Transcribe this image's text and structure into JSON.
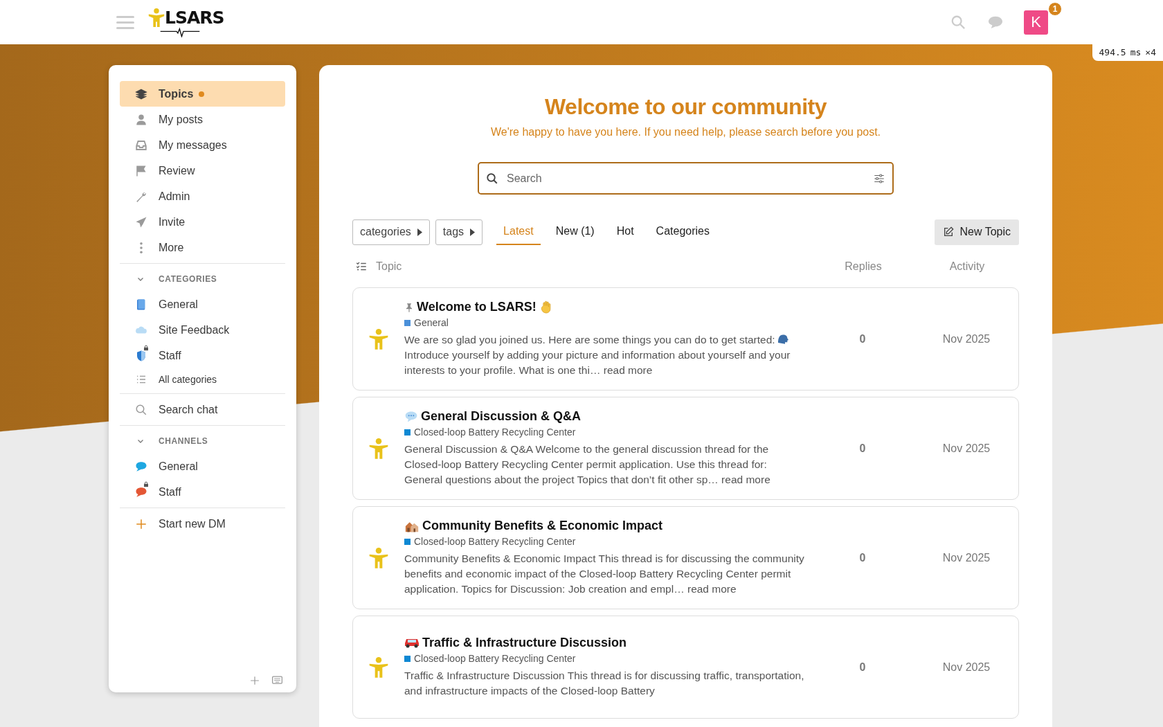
{
  "header": {
    "logo": "LSARS",
    "avatar": {
      "letter": "K",
      "notifications": "1"
    }
  },
  "perf_badge": {
    "value": "494.5",
    "unit": "ms",
    "count": "×4"
  },
  "sidebar": {
    "items": [
      {
        "label": "Topics",
        "selected": true,
        "has_new": true,
        "kind": "layers"
      },
      {
        "label": "My posts",
        "selected": false,
        "has_new": false,
        "kind": "user"
      },
      {
        "label": "My messages",
        "selected": false,
        "has_new": false,
        "kind": "inbox"
      },
      {
        "label": "Review",
        "selected": false,
        "has_new": false,
        "kind": "flag"
      },
      {
        "label": "Admin",
        "selected": false,
        "has_new": false,
        "kind": "wrench"
      },
      {
        "label": "Invite",
        "selected": false,
        "has_new": false,
        "kind": "plane"
      },
      {
        "label": "More",
        "selected": false,
        "has_new": false,
        "kind": "dots"
      }
    ],
    "categories": {
      "title": "CATEGORIES",
      "expanded": true,
      "items": [
        {
          "label": "General",
          "kind": "book",
          "locked": false
        },
        {
          "label": "Site Feedback",
          "kind": "cloud",
          "locked": false
        },
        {
          "label": "Staff",
          "kind": "shield",
          "locked": true
        }
      ],
      "all_link": "All categories"
    },
    "search_chat": "Search chat",
    "channels": {
      "title": "CHANNELS",
      "expanded": true,
      "items": [
        {
          "label": "General",
          "color": "#1ea7e1",
          "locked": false
        },
        {
          "label": "Staff",
          "color": "#e45735",
          "locked": true
        }
      ]
    },
    "new_dm": "Start new DM"
  },
  "main": {
    "title": "Welcome to our community",
    "subtitle": "We're happy to have you here. If you need help, please search before you post.",
    "search": {
      "placeholder": "Search"
    },
    "filters": [
      "categories",
      "tags"
    ],
    "tabs": [
      {
        "label": "Latest",
        "selected": true
      },
      {
        "label": "New (1)",
        "selected": false
      },
      {
        "label": "Hot",
        "selected": false
      },
      {
        "label": "Categories",
        "selected": false
      }
    ],
    "new_topic": "New Topic",
    "columns": [
      "Topic",
      "Replies",
      "Activity"
    ],
    "topics": [
      {
        "kind": "welcome",
        "pinned": true,
        "title": "Welcome to LSARS!",
        "category": {
          "label": "General",
          "color": "#4a90d9"
        },
        "excerpt_before": "We are so glad you joined us. Here are some things you can do to get started:",
        "excerpt_after": "Introduce yourself by adding your picture and information about yourself and your interests to your profile. What is one thi…",
        "read_more": "read more",
        "replies": "0",
        "activity": "Nov 2025"
      },
      {
        "kind": "discussion",
        "pinned": false,
        "title": "General Discussion & Q&A",
        "category": {
          "label": "Closed-loop Battery Recycling Center",
          "color": "#0e88d3"
        },
        "excerpt_before": "General Discussion & Q&A Welcome to the general discussion thread for the Closed-loop Battery Recycling Center permit application. Use this thread for: General questions about the project Topics that don’t fit other sp…",
        "read_more": "read more",
        "replies": "0",
        "activity": "Nov 2025"
      },
      {
        "kind": "community",
        "pinned": false,
        "title": "Community Benefits & Economic Impact",
        "category": {
          "label": "Closed-loop Battery Recycling Center",
          "color": "#0e88d3"
        },
        "excerpt_before": "Community Benefits & Economic Impact This thread is for discussing the community benefits and economic impact of the Closed-loop Battery Recycling Center permit application. Topics for Discussion: Job creation and empl…",
        "read_more": "read more",
        "replies": "0",
        "activity": "Nov 2025"
      },
      {
        "kind": "traffic",
        "pinned": false,
        "title": "Traffic & Infrastructure Discussion",
        "category": {
          "label": "Closed-loop Battery Recycling Center",
          "color": "#0e88d3"
        },
        "excerpt_before": "Traffic & Infrastructure Discussion This thread is for discussing traffic, transportation, and infrastructure impacts of the Closed-loop Battery",
        "replies": "0",
        "activity": "Nov 2025"
      }
    ]
  }
}
